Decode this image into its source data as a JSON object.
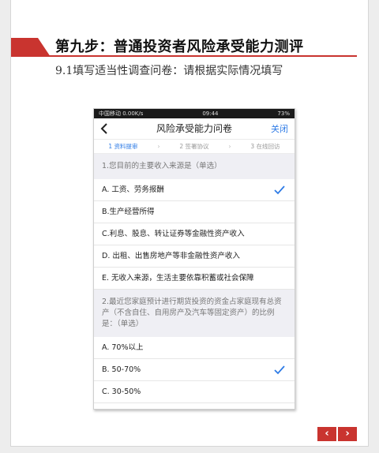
{
  "document": {
    "heading": "第九步：普通投资者风险承受能力测评",
    "subheading": "9.1填写适当性调查问卷：请根据实际情况填写"
  },
  "phone": {
    "status": {
      "left": "中国移动 0.00K/s",
      "time": "09:44",
      "right": "73%"
    },
    "nav": {
      "title": "风险承受能力问卷",
      "close": "关闭"
    },
    "steps": [
      {
        "label": "1 资料提审",
        "active": true
      },
      {
        "label": "2 签署协议",
        "active": false
      },
      {
        "label": "3 在线回访",
        "active": false
      }
    ],
    "questions": [
      {
        "text": "1.您目前的主要收入来源是（单选）",
        "options": [
          {
            "text": "A. 工资、劳务报酬",
            "checked": true
          },
          {
            "text": "B.生产经营所得",
            "checked": false
          },
          {
            "text": "C.利息、股息、转让证券等金融性资产收入",
            "checked": false
          },
          {
            "text": "D. 出租、出售房地产等非金融性资产收入",
            "checked": false
          },
          {
            "text": "E. 无收入来源，生活主要依靠积蓄或社会保障",
            "checked": false
          }
        ]
      },
      {
        "text": "2.最近您家庭预计进行期货投资的资金占家庭现有总资产（不含自住、自用房产及汽车等固定资产）的比例是：（单选）",
        "options": [
          {
            "text": "A. 70%以上",
            "checked": false
          },
          {
            "text": "B. 50-70%",
            "checked": true
          },
          {
            "text": "C. 30-50%",
            "checked": false
          }
        ]
      }
    ]
  },
  "pager": {
    "prev": "‹",
    "next": "›"
  },
  "colors": {
    "accent_red": "#c9342f",
    "link_blue": "#2e7be6"
  }
}
